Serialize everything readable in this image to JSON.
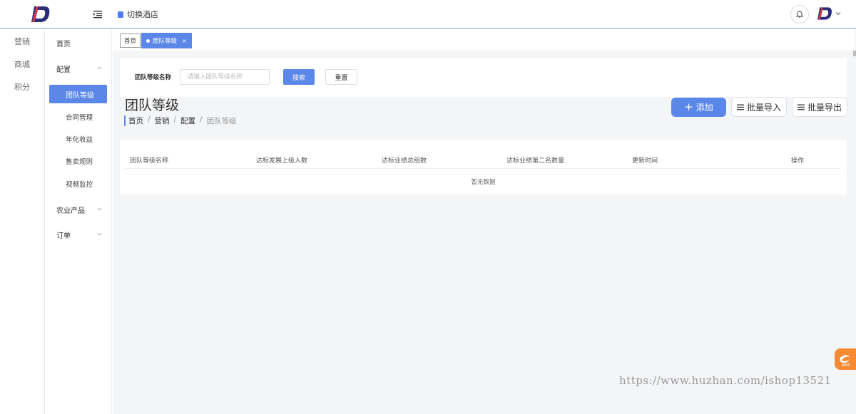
{
  "header": {
    "switch_hotel_label": "切换酒店",
    "logo_letter": "D"
  },
  "rail": {
    "items": [
      {
        "label": "营销"
      },
      {
        "label": "商城"
      },
      {
        "label": "积分"
      }
    ]
  },
  "sidebar": {
    "items": [
      {
        "label": "首页"
      },
      {
        "label": "配置"
      },
      {
        "label": "团队等级"
      },
      {
        "label": "合同管理"
      },
      {
        "label": "年化收益"
      },
      {
        "label": "售卖规则"
      },
      {
        "label": "视频监控"
      },
      {
        "label": "农业产品"
      },
      {
        "label": "订单"
      }
    ]
  },
  "tabs": {
    "home": "首页",
    "active": "团队等级",
    "close": "×"
  },
  "search": {
    "label": "团队等级名称",
    "placeholder": "请输入团队等级名称",
    "search_button": "搜索",
    "reset_button": "重置"
  },
  "page": {
    "title": "团队等级",
    "breadcrumb": [
      "首页",
      "营销",
      "配置",
      "团队等级"
    ],
    "breadcrumb_sep": "/"
  },
  "actions": {
    "add": "添加",
    "add_icon": "+",
    "import": "批量导入",
    "export": "批量导出"
  },
  "table": {
    "columns": [
      "团队等级名称",
      "达标发展上级人数",
      "达标业绩总组数",
      "达标业绩第二名数量",
      "更新时间",
      "操作"
    ],
    "empty_text": "暂无数据"
  },
  "watermark": "https://www.huzhan.com/ishop13521",
  "widget_label": "1688",
  "colors": {
    "primary": "#5b87e8",
    "widget": "#f58a33"
  }
}
